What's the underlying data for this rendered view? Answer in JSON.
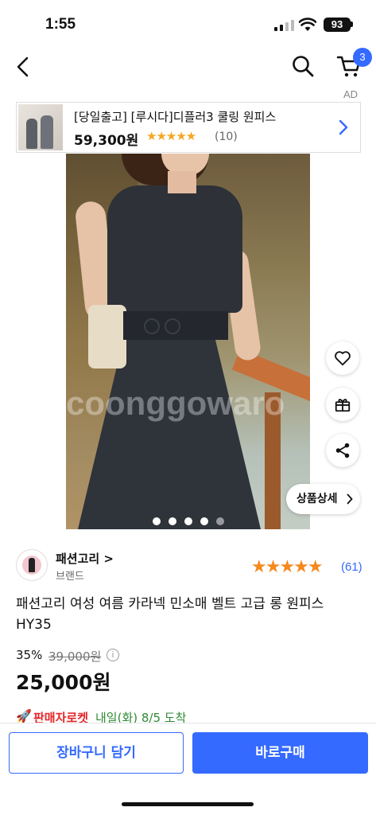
{
  "status_bar": {
    "time": "1:55",
    "battery": "93"
  },
  "nav": {
    "cart_count": "3",
    "ad_label": "AD"
  },
  "ad_banner": {
    "title": "[당일출고] [루시다]디플러3 쿨링 원피스",
    "price": "59,300원",
    "stars": "★★★★★",
    "review_count": "(10)"
  },
  "gallery": {
    "watermark": "coonggowaro",
    "total_images": 5,
    "current_index": 5
  },
  "detail_button": {
    "label": "상품상세"
  },
  "brand": {
    "name": "패션고리 >",
    "sub": "브랜드"
  },
  "rating": {
    "stars": "★★★★★",
    "count": "(61)",
    "accent": "#f48a1f"
  },
  "product": {
    "title": "패션고리 여성 여름 카라넥 민소매 벨트 고급 롱 원피스 HY35",
    "discount": "35%",
    "original_price": "39,000원",
    "price": "25,000원"
  },
  "delivery": {
    "badge": "판매자로켓",
    "text": "내일(화) 8/5 도착"
  },
  "actions": {
    "cart_label": "장바구니 담기",
    "buy_label": "바로구매"
  },
  "colors": {
    "accent": "#346aff",
    "rocket_red": "#e52528",
    "delivery_green": "#2f8a34"
  },
  "icons": [
    "back-icon",
    "search-icon",
    "cart-icon",
    "chevron-right-icon",
    "heart-icon",
    "gift-icon",
    "share-icon",
    "info-icon",
    "rocket-icon"
  ]
}
